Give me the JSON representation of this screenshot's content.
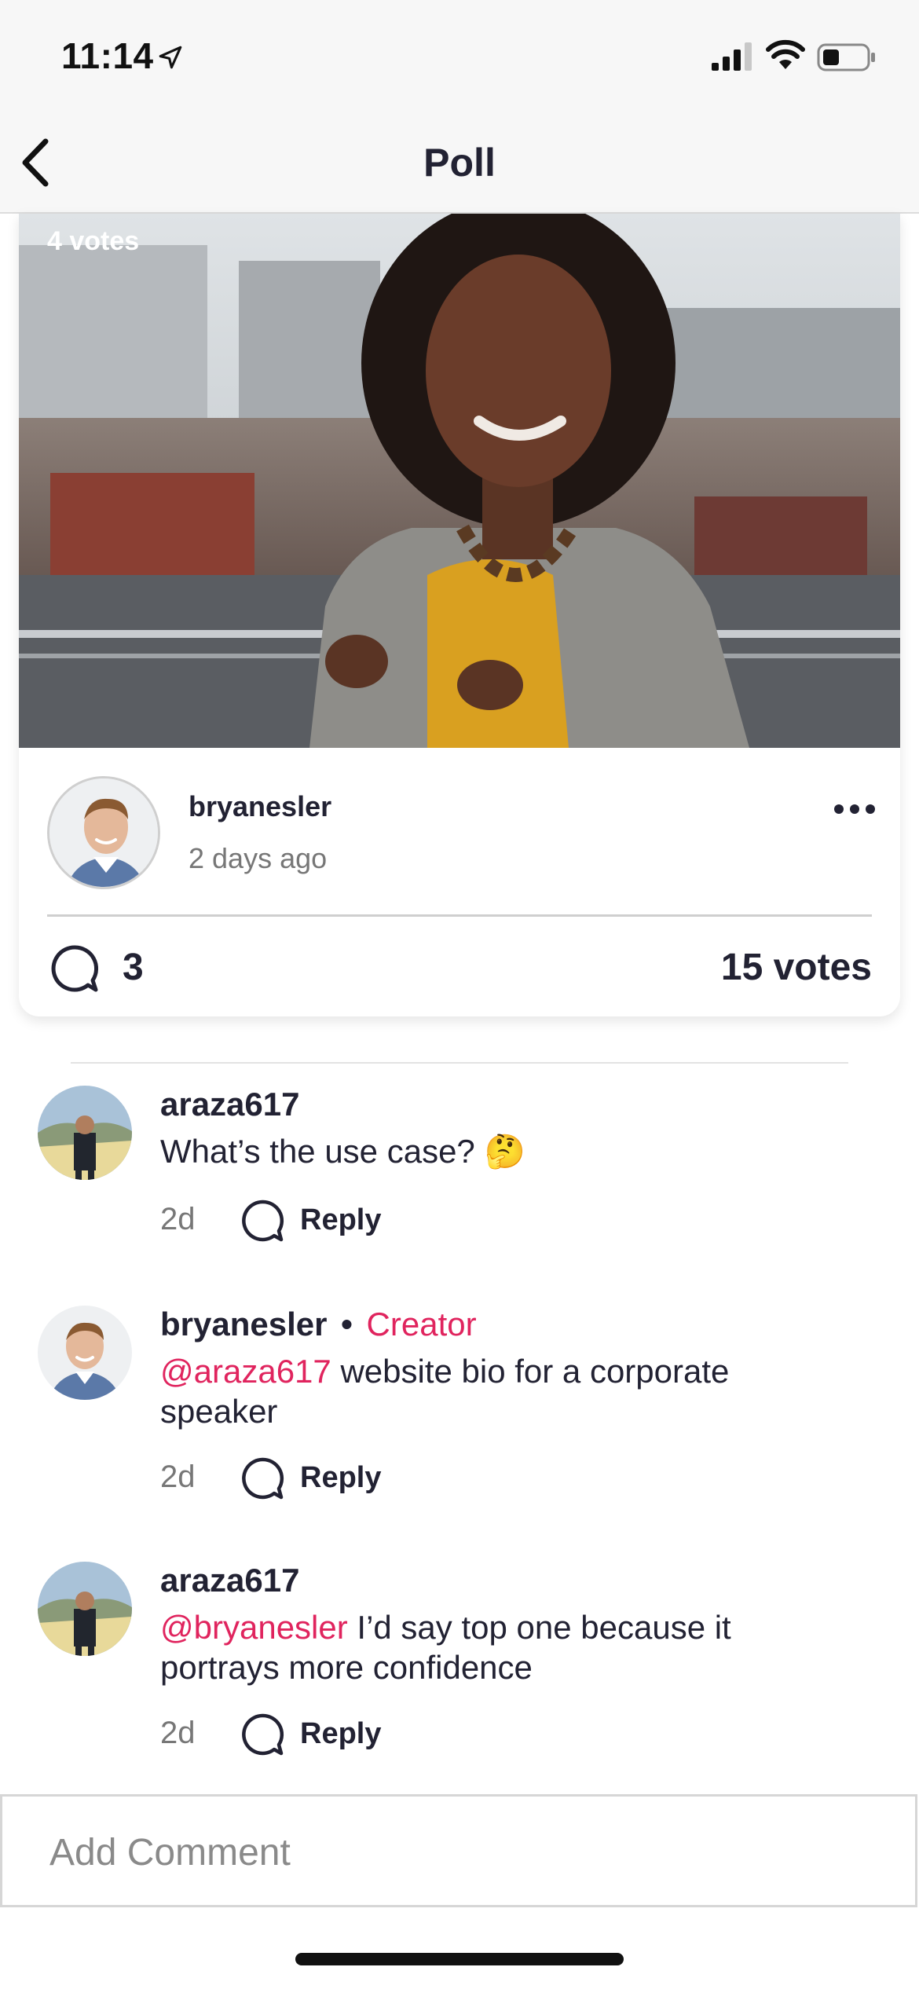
{
  "status_bar": {
    "time": "11:14"
  },
  "nav": {
    "title": "Poll"
  },
  "post": {
    "option_votes": "4 votes",
    "author": "bryanesler",
    "posted": "2 days ago",
    "comment_count": "3",
    "total_votes": "15 votes"
  },
  "comments": [
    {
      "user": "araza617",
      "creator": "",
      "mention": "",
      "text": "What’s the use case?",
      "emoji": "🤔",
      "age": "2d",
      "reply": "Reply"
    },
    {
      "user": "bryanesler",
      "creator": "Creator",
      "mention": "@araza617",
      "text": " website bio for a corporate speaker",
      "emoji": "",
      "age": "2d",
      "reply": "Reply"
    },
    {
      "user": "araza617",
      "creator": "",
      "mention": "@bryanesler",
      "text": " I’d say top one because it portrays more confidence",
      "emoji": "",
      "age": "2d",
      "reply": "Reply"
    }
  ],
  "composer": {
    "placeholder": "Add Comment"
  },
  "colors": {
    "accent": "#e0245e",
    "text": "#222233",
    "muted": "#777777"
  }
}
